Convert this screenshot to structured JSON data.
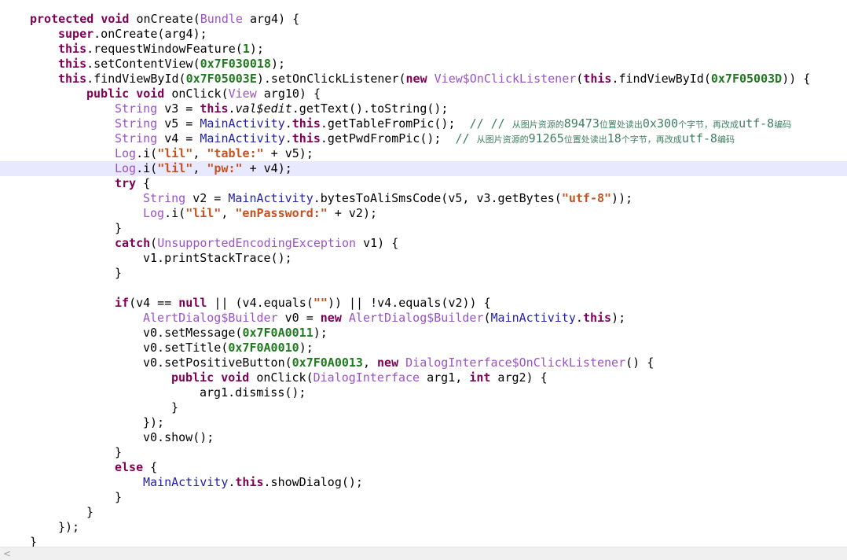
{
  "editor": {
    "highlight_line": 10,
    "lines": [
      {
        "indent": 1,
        "tokens": [
          {
            "t": "protected",
            "c": "kw"
          },
          {
            "t": " "
          },
          {
            "t": "void",
            "c": "kw"
          },
          {
            "t": " onCreate("
          },
          {
            "t": "Bundle",
            "c": "ty"
          },
          {
            "t": " arg4) {"
          }
        ]
      },
      {
        "indent": 2,
        "tokens": [
          {
            "t": "super",
            "c": "kw"
          },
          {
            "t": ".onCreate(arg4);"
          }
        ]
      },
      {
        "indent": 2,
        "tokens": [
          {
            "t": "this",
            "c": "kw"
          },
          {
            "t": ".requestWindowFeature("
          },
          {
            "t": "1",
            "c": "num"
          },
          {
            "t": ");"
          }
        ]
      },
      {
        "indent": 2,
        "tokens": [
          {
            "t": "this",
            "c": "kw"
          },
          {
            "t": ".setContentView("
          },
          {
            "t": "0x7F030018",
            "c": "num"
          },
          {
            "t": ");"
          }
        ]
      },
      {
        "indent": 2,
        "tokens": [
          {
            "t": "this",
            "c": "kw"
          },
          {
            "t": ".findViewById("
          },
          {
            "t": "0x7F05003E",
            "c": "num"
          },
          {
            "t": ").setOnClickListener("
          },
          {
            "t": "new",
            "c": "kw"
          },
          {
            "t": " "
          },
          {
            "t": "View$OnClickListener",
            "c": "ty"
          },
          {
            "t": "("
          },
          {
            "t": "this",
            "c": "kw"
          },
          {
            "t": ".findViewById("
          },
          {
            "t": "0x7F05003D",
            "c": "num"
          },
          {
            "t": ")) {"
          }
        ]
      },
      {
        "indent": 3,
        "tokens": [
          {
            "t": "public",
            "c": "kw"
          },
          {
            "t": " "
          },
          {
            "t": "void",
            "c": "kw"
          },
          {
            "t": " onClick("
          },
          {
            "t": "View",
            "c": "ty"
          },
          {
            "t": " arg10) {"
          }
        ]
      },
      {
        "indent": 4,
        "tokens": [
          {
            "t": "String",
            "c": "ty"
          },
          {
            "t": " v3 = "
          },
          {
            "t": "this",
            "c": "kw"
          },
          {
            "t": "."
          },
          {
            "t": "val$edit",
            "c": "it"
          },
          {
            "t": ".getText().toString();"
          }
        ]
      },
      {
        "indent": 4,
        "tokens": [
          {
            "t": "String",
            "c": "ty"
          },
          {
            "t": " v5 = "
          },
          {
            "t": "MainActivity",
            "c": "cl"
          },
          {
            "t": "."
          },
          {
            "t": "this",
            "c": "kw"
          },
          {
            "t": ".getTableFromPic();  "
          },
          {
            "t": "// // ",
            "c": "cm"
          },
          {
            "t": "从图片资源的",
            "c": "cmz"
          },
          {
            "t": "89473",
            "c": "cm"
          },
          {
            "t": "位置处读出",
            "c": "cmz"
          },
          {
            "t": "0x300",
            "c": "cm"
          },
          {
            "t": "个字节，再改成",
            "c": "cmz"
          },
          {
            "t": "utf-8",
            "c": "cm"
          },
          {
            "t": "编码",
            "c": "cmz"
          }
        ]
      },
      {
        "indent": 4,
        "tokens": [
          {
            "t": "String",
            "c": "ty"
          },
          {
            "t": " v4 = "
          },
          {
            "t": "MainActivity",
            "c": "cl"
          },
          {
            "t": "."
          },
          {
            "t": "this",
            "c": "kw"
          },
          {
            "t": ".getPwdFromPic();  "
          },
          {
            "t": "// ",
            "c": "cm"
          },
          {
            "t": "从图片资源的",
            "c": "cmz"
          },
          {
            "t": "91265",
            "c": "cm"
          },
          {
            "t": "位置处读出",
            "c": "cmz"
          },
          {
            "t": "18",
            "c": "cm"
          },
          {
            "t": "个字节，再改成",
            "c": "cmz"
          },
          {
            "t": "utf-8",
            "c": "cm"
          },
          {
            "t": "编码",
            "c": "cmz"
          }
        ]
      },
      {
        "indent": 4,
        "tokens": [
          {
            "t": "Log",
            "c": "ty"
          },
          {
            "t": ".i("
          },
          {
            "t": "\"lil\"",
            "c": "str"
          },
          {
            "t": ", "
          },
          {
            "t": "\"table:\"",
            "c": "str"
          },
          {
            "t": " + v5);"
          }
        ]
      },
      {
        "indent": 4,
        "tokens": [
          {
            "t": "Log",
            "c": "ty"
          },
          {
            "t": ".i("
          },
          {
            "t": "\"lil\"",
            "c": "str"
          },
          {
            "t": ", "
          },
          {
            "t": "\"pw:\"",
            "c": "str"
          },
          {
            "t": " + v4);"
          }
        ]
      },
      {
        "indent": 4,
        "tokens": [
          {
            "t": "try",
            "c": "kw"
          },
          {
            "t": " {"
          }
        ]
      },
      {
        "indent": 5,
        "tokens": [
          {
            "t": "String",
            "c": "ty"
          },
          {
            "t": " v2 = "
          },
          {
            "t": "MainActivity",
            "c": "cl"
          },
          {
            "t": ".bytesToAliSmsCode(v5, v3.getBytes("
          },
          {
            "t": "\"utf-8\"",
            "c": "str"
          },
          {
            "t": "));"
          }
        ]
      },
      {
        "indent": 5,
        "tokens": [
          {
            "t": "Log",
            "c": "ty"
          },
          {
            "t": ".i("
          },
          {
            "t": "\"lil\"",
            "c": "str"
          },
          {
            "t": ", "
          },
          {
            "t": "\"enPassword:\"",
            "c": "str"
          },
          {
            "t": " + v2);"
          }
        ]
      },
      {
        "indent": 4,
        "tokens": [
          {
            "t": "}"
          }
        ]
      },
      {
        "indent": 4,
        "tokens": [
          {
            "t": "catch",
            "c": "kw"
          },
          {
            "t": "("
          },
          {
            "t": "UnsupportedEncodingException",
            "c": "ty"
          },
          {
            "t": " v1) {"
          }
        ]
      },
      {
        "indent": 5,
        "tokens": [
          {
            "t": "v1.printStackTrace();"
          }
        ]
      },
      {
        "indent": 4,
        "tokens": [
          {
            "t": "}"
          }
        ]
      },
      {
        "indent": 0,
        "tokens": []
      },
      {
        "indent": 4,
        "tokens": [
          {
            "t": "if",
            "c": "kw"
          },
          {
            "t": "(v4 == "
          },
          {
            "t": "null",
            "c": "kw"
          },
          {
            "t": " || (v4.equals("
          },
          {
            "t": "\"\"",
            "c": "str"
          },
          {
            "t": ")) || !v4.equals(v2)) {"
          }
        ]
      },
      {
        "indent": 5,
        "tokens": [
          {
            "t": "AlertDialog$Builder",
            "c": "ty"
          },
          {
            "t": " v0 = "
          },
          {
            "t": "new",
            "c": "kw"
          },
          {
            "t": " "
          },
          {
            "t": "AlertDialog$Builder",
            "c": "ty"
          },
          {
            "t": "("
          },
          {
            "t": "MainActivity",
            "c": "cl"
          },
          {
            "t": "."
          },
          {
            "t": "this",
            "c": "kw"
          },
          {
            "t": ");"
          }
        ]
      },
      {
        "indent": 5,
        "tokens": [
          {
            "t": "v0.setMessage("
          },
          {
            "t": "0x7F0A0011",
            "c": "num"
          },
          {
            "t": ");"
          }
        ]
      },
      {
        "indent": 5,
        "tokens": [
          {
            "t": "v0.setTitle("
          },
          {
            "t": "0x7F0A0010",
            "c": "num"
          },
          {
            "t": ");"
          }
        ]
      },
      {
        "indent": 5,
        "tokens": [
          {
            "t": "v0.setPositiveButton("
          },
          {
            "t": "0x7F0A0013",
            "c": "num"
          },
          {
            "t": ", "
          },
          {
            "t": "new",
            "c": "kw"
          },
          {
            "t": " "
          },
          {
            "t": "DialogInterface$OnClickListener",
            "c": "ty"
          },
          {
            "t": "() {"
          }
        ]
      },
      {
        "indent": 6,
        "tokens": [
          {
            "t": "public",
            "c": "kw"
          },
          {
            "t": " "
          },
          {
            "t": "void",
            "c": "kw"
          },
          {
            "t": " onClick("
          },
          {
            "t": "DialogInterface",
            "c": "ty"
          },
          {
            "t": " arg1, "
          },
          {
            "t": "int",
            "c": "kw"
          },
          {
            "t": " arg2) {"
          }
        ]
      },
      {
        "indent": 7,
        "tokens": [
          {
            "t": "arg1.dismiss();"
          }
        ]
      },
      {
        "indent": 6,
        "tokens": [
          {
            "t": "}"
          }
        ]
      },
      {
        "indent": 5,
        "tokens": [
          {
            "t": "});"
          }
        ]
      },
      {
        "indent": 5,
        "tokens": [
          {
            "t": "v0.show();"
          }
        ]
      },
      {
        "indent": 4,
        "tokens": [
          {
            "t": "}"
          }
        ]
      },
      {
        "indent": 4,
        "tokens": [
          {
            "t": "else",
            "c": "kw"
          },
          {
            "t": " {"
          }
        ]
      },
      {
        "indent": 5,
        "tokens": [
          {
            "t": "MainActivity",
            "c": "cl"
          },
          {
            "t": "."
          },
          {
            "t": "this",
            "c": "kw"
          },
          {
            "t": ".showDialog();"
          }
        ]
      },
      {
        "indent": 4,
        "tokens": [
          {
            "t": "}"
          }
        ]
      },
      {
        "indent": 3,
        "tokens": [
          {
            "t": "}"
          }
        ]
      },
      {
        "indent": 2,
        "tokens": [
          {
            "t": "});"
          }
        ]
      },
      {
        "indent": 1,
        "tokens": [
          {
            "t": "}"
          }
        ]
      }
    ]
  },
  "scrollbar": {
    "left_arrow_icon": "chevron-left-icon",
    "left_arrow_glyph": "<"
  }
}
